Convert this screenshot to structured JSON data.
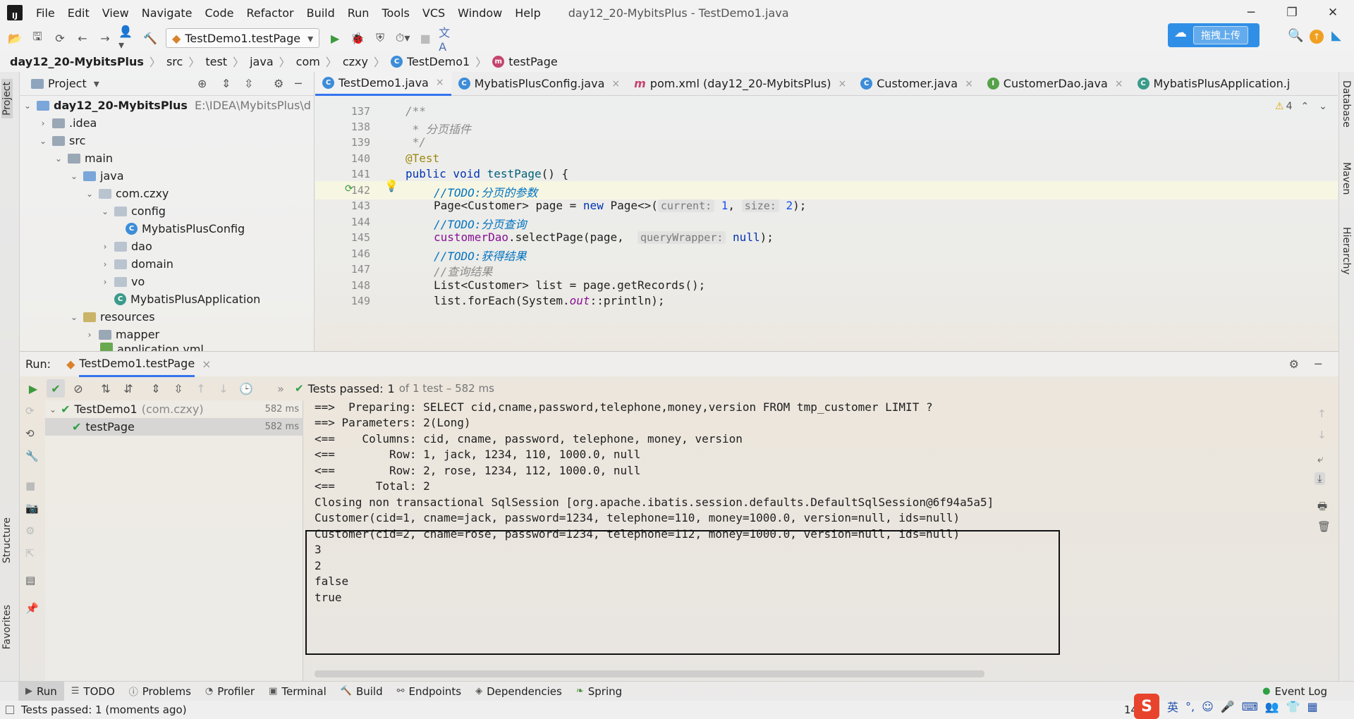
{
  "menubar": {
    "items": [
      "File",
      "Edit",
      "View",
      "Navigate",
      "Code",
      "Refactor",
      "Build",
      "Run",
      "Tools",
      "VCS",
      "Window",
      "Help"
    ],
    "window_title": "day12_20-MybitsPlus - TestDemo1.java"
  },
  "toolbar": {
    "run_config": "TestDemo1.testPage",
    "upload_label": "拖拽上传"
  },
  "breadcrumbs": [
    "day12_20-MybitsPlus",
    "src",
    "test",
    "java",
    "com",
    "czxy",
    "TestDemo1",
    "testPage"
  ],
  "project": {
    "header": "Project",
    "root": "day12_20-MybitsPlus",
    "root_path": "E:\\IDEA\\MybitsPlus\\d",
    "nodes": [
      ".idea",
      "src",
      "main",
      "java",
      "com.czxy",
      "config",
      "MybatisPlusConfig",
      "dao",
      "domain",
      "vo",
      "MybatisPlusApplication",
      "resources",
      "mapper",
      "application.yml"
    ]
  },
  "editor": {
    "tabs": [
      "TestDemo1.java",
      "MybatisPlusConfig.java",
      "pom.xml (day12_20-MybitsPlus)",
      "Customer.java",
      "CustomerDao.java",
      "MybatisPlusApplication.j"
    ],
    "warnings": "4",
    "line_numbers": [
      "137",
      "138",
      "139",
      "140",
      "141",
      "142",
      "143",
      "144",
      "145",
      "146",
      "147",
      "148",
      "149"
    ],
    "lines": {
      "l137": "/**",
      "l138": " * 分页插件",
      "l139": " */",
      "l140": "@Test",
      "l141_kw": "public void ",
      "l141_fn": "testPage",
      "l141_rest": "() {",
      "l142": "//TODO:分页的参数",
      "l143_a": "Page<Customer> page = ",
      "l143_new": "new",
      "l143_b": " Page<>(",
      "l143_hint1": "current:",
      "l143_v1": "1",
      "l143_hint2": "size:",
      "l143_v2": "2",
      "l143_end": ");",
      "l144": "//TODO:分页查询",
      "l145_fld": "customerDao",
      "l145_a": ".selectPage(page, ",
      "l145_hint": "queryWrapper:",
      "l145_null": "null",
      "l145_end": ");",
      "l146": "//TODO:获得结果",
      "l147": "//查询结果",
      "l148": "List<Customer> list = page.getRecords();",
      "l149_a": "list.forEach(System.",
      "l149_out": "out",
      "l149_b": "::println);"
    }
  },
  "run": {
    "label": "Run:",
    "tab": "TestDemo1.testPage",
    "status_passed": "Tests passed:",
    "status_count": "1",
    "status_rest": "of 1 test – 582 ms",
    "tree": [
      {
        "name": "TestDemo1",
        "pkg": "(com.czxy)",
        "ms": "582 ms"
      },
      {
        "name": "testPage",
        "ms": "582 ms"
      }
    ],
    "console": [
      "==>  Preparing: SELECT cid,cname,password,telephone,money,version FROM tmp_customer LIMIT ?",
      "==> Parameters: 2(Long)",
      "<==    Columns: cid, cname, password, telephone, money, version",
      "<==        Row: 1, jack, 1234, 110, 1000.0, null",
      "<==        Row: 2, rose, 1234, 112, 1000.0, null",
      "<==      Total: 2",
      "Closing non transactional SqlSession [org.apache.ibatis.session.defaults.DefaultSqlSession@6f94a5a5]",
      "Customer(cid=1, cname=jack, password=1234, telephone=110, money=1000.0, version=null, ids=null)",
      "Customer(cid=2, cname=rose, password=1234, telephone=112, money=1000.0, version=null, ids=null)",
      "3",
      "2",
      "false",
      "true"
    ]
  },
  "bottombar": [
    "Run",
    "TODO",
    "Problems",
    "Profiler",
    "Terminal",
    "Build",
    "Endpoints",
    "Dependencies",
    "Spring"
  ],
  "event_log": "Event Log",
  "statusbar": {
    "text": "Tests passed: 1 (moments ago)",
    "position": "14"
  },
  "sidetabs": {
    "left": [
      "Project",
      "Structure",
      "Favorites"
    ],
    "right": [
      "Database",
      "Maven",
      "Hierarchy"
    ]
  },
  "ime": {
    "logo": "S",
    "lang": "英"
  }
}
